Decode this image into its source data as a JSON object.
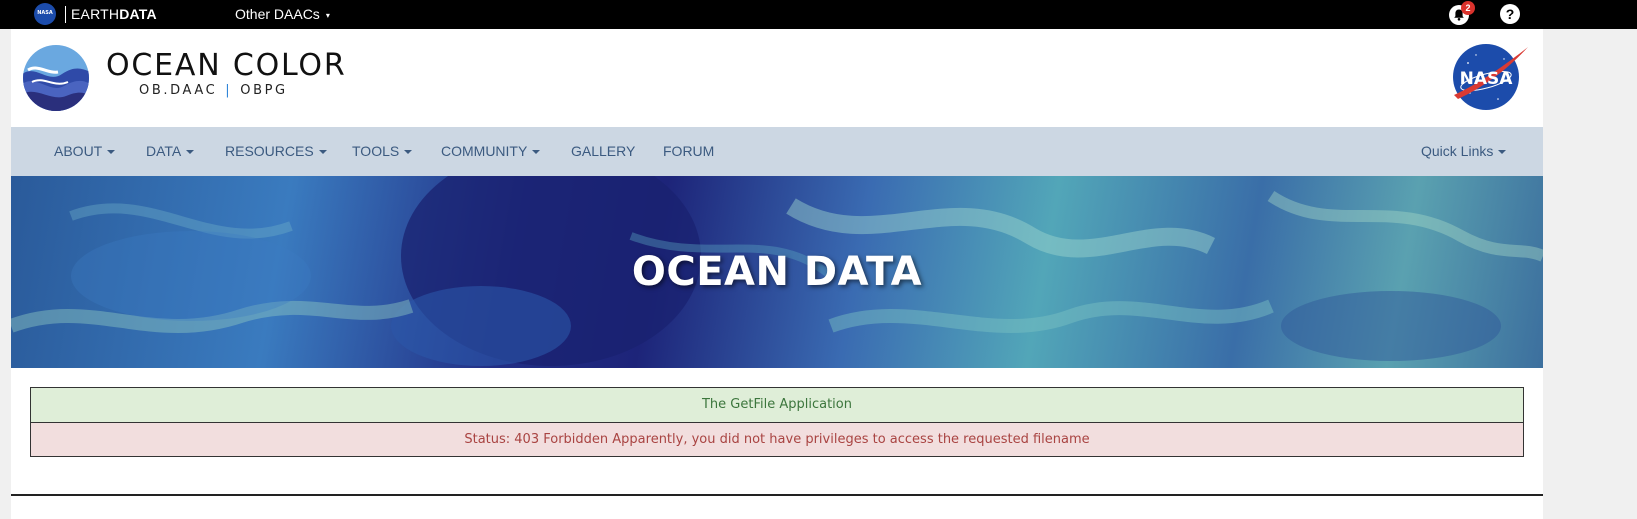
{
  "topbar": {
    "nasa_mini_text": "NASA",
    "earthdata_prefix": "EARTH",
    "earthdata_bold": "DATA",
    "other_daacs": "Other DAACs",
    "notification_count": "2",
    "help_label": "?"
  },
  "header": {
    "title": "OCEAN COLOR",
    "subtitle_left": "OB.DAAC",
    "subtitle_sep": "|",
    "subtitle_right": "OBPG",
    "nasa_logo_text": "NASA"
  },
  "nav": {
    "items": [
      {
        "label": "ABOUT",
        "dropdown": true
      },
      {
        "label": "DATA",
        "dropdown": true
      },
      {
        "label": "RESOURCES",
        "dropdown": true
      },
      {
        "label": "TOOLS",
        "dropdown": true
      },
      {
        "label": "COMMUNITY",
        "dropdown": true
      },
      {
        "label": "GALLERY",
        "dropdown": false
      },
      {
        "label": "FORUM",
        "dropdown": false
      }
    ],
    "quick_links": "Quick Links"
  },
  "hero": {
    "title": "OCEAN DATA"
  },
  "alerts": {
    "info": "The GetFile Application",
    "error": "Status: 403 Forbidden Apparently, you did not have privileges to access the requested filename"
  },
  "colors": {
    "nav_bg": "#ccd7e3",
    "nav_text": "#3b5a80",
    "success_bg": "#dfeed8",
    "danger_bg": "#f2dede",
    "badge": "#d9322c"
  }
}
